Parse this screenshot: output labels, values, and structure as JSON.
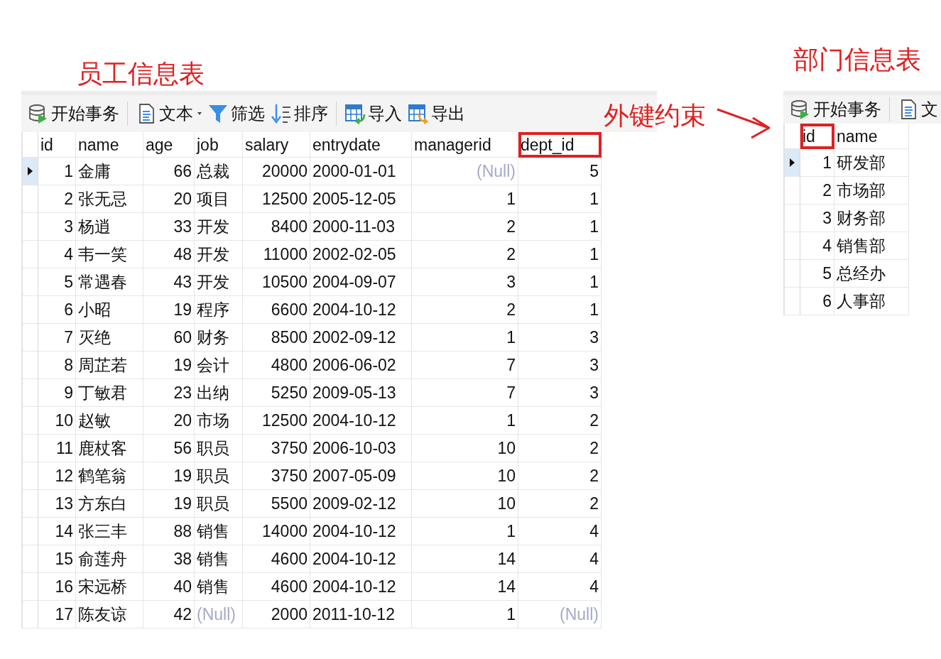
{
  "annotations": {
    "employee_title": "员工信息表",
    "department_title": "部门信息表",
    "foreign_key_label": "外键约束"
  },
  "employee_panel": {
    "toolbar": [
      [
        {
          "kind": "transaction",
          "label": "开始事务"
        }
      ],
      [
        {
          "kind": "text",
          "label": "文本",
          "dropdown": true
        },
        {
          "kind": "filter",
          "label": "筛选"
        },
        {
          "kind": "sort",
          "label": "排序"
        }
      ],
      [
        {
          "kind": "import",
          "label": "导入"
        },
        {
          "kind": "export",
          "label": "导出"
        }
      ]
    ],
    "table": {
      "columns": [
        {
          "label": "id",
          "kind": "number",
          "highlighted": false
        },
        {
          "label": "name",
          "kind": "text",
          "highlighted": false
        },
        {
          "label": "age",
          "kind": "number",
          "highlighted": false
        },
        {
          "label": "job",
          "kind": "text",
          "highlighted": false
        },
        {
          "label": "salary",
          "kind": "number",
          "highlighted": false
        },
        {
          "label": "entrydate",
          "kind": "text",
          "highlighted": false
        },
        {
          "label": "managerid",
          "kind": "number",
          "highlighted": false
        },
        {
          "label": "dept_id",
          "kind": "number",
          "highlighted": true
        }
      ],
      "rows": [
        {
          "selected": true,
          "cells": [
            "1",
            "金庸",
            "66",
            "总裁",
            "20000",
            "2000-01-01",
            {
              "kind": "null",
              "text": "(Null)"
            },
            "5"
          ]
        },
        {
          "selected": false,
          "cells": [
            "2",
            "张无忌",
            "20",
            "项目",
            "12500",
            "2005-12-05",
            "1",
            "1"
          ]
        },
        {
          "selected": false,
          "cells": [
            "3",
            "杨逍",
            "33",
            "开发",
            "8400",
            "2000-11-03",
            "2",
            "1"
          ]
        },
        {
          "selected": false,
          "cells": [
            "4",
            "韦一笑",
            "48",
            "开发",
            "11000",
            "2002-02-05",
            "2",
            "1"
          ]
        },
        {
          "selected": false,
          "cells": [
            "5",
            "常遇春",
            "43",
            "开发",
            "10500",
            "2004-09-07",
            "3",
            "1"
          ]
        },
        {
          "selected": false,
          "cells": [
            "6",
            "小昭",
            "19",
            "程序",
            "6600",
            "2004-10-12",
            "2",
            "1"
          ]
        },
        {
          "selected": false,
          "cells": [
            "7",
            "灭绝",
            "60",
            "财务",
            "8500",
            "2002-09-12",
            "1",
            "3"
          ]
        },
        {
          "selected": false,
          "cells": [
            "8",
            "周芷若",
            "19",
            "会计",
            "4800",
            "2006-06-02",
            "7",
            "3"
          ]
        },
        {
          "selected": false,
          "cells": [
            "9",
            "丁敏君",
            "23",
            "出纳",
            "5250",
            "2009-05-13",
            "7",
            "3"
          ]
        },
        {
          "selected": false,
          "cells": [
            "10",
            "赵敏",
            "20",
            "市场",
            "12500",
            "2004-10-12",
            "1",
            "2"
          ]
        },
        {
          "selected": false,
          "cells": [
            "11",
            "鹿杖客",
            "56",
            "职员",
            "3750",
            "2006-10-03",
            "10",
            "2"
          ]
        },
        {
          "selected": false,
          "cells": [
            "12",
            "鹤笔翁",
            "19",
            "职员",
            "3750",
            "2007-05-09",
            "10",
            "2"
          ]
        },
        {
          "selected": false,
          "cells": [
            "13",
            "方东白",
            "19",
            "职员",
            "5500",
            "2009-02-12",
            "10",
            "2"
          ]
        },
        {
          "selected": false,
          "cells": [
            "14",
            "张三丰",
            "88",
            "销售",
            "14000",
            "2004-10-12",
            "1",
            "4"
          ]
        },
        {
          "selected": false,
          "cells": [
            "15",
            "俞莲舟",
            "38",
            "销售",
            "4600",
            "2004-10-12",
            "14",
            "4"
          ]
        },
        {
          "selected": false,
          "cells": [
            "16",
            "宋远桥",
            "40",
            "销售",
            "4600",
            "2004-10-12",
            "14",
            "4"
          ]
        },
        {
          "selected": false,
          "cells": [
            "17",
            "陈友谅",
            "42",
            {
              "kind": "null",
              "text": "(Null)"
            },
            "2000",
            "2011-10-12",
            "1",
            {
              "kind": "null",
              "text": "(Null)"
            }
          ]
        }
      ]
    }
  },
  "department_panel": {
    "toolbar": [
      [
        {
          "kind": "transaction",
          "label": "开始事务"
        }
      ],
      [
        {
          "kind": "text",
          "label": "文",
          "dropdown": false
        }
      ]
    ],
    "table": {
      "columns": [
        {
          "label": "id",
          "kind": "number",
          "highlighted": true
        },
        {
          "label": "name",
          "kind": "text",
          "highlighted": false
        }
      ],
      "rows": [
        {
          "selected": true,
          "cells": [
            "1",
            "研发部"
          ]
        },
        {
          "selected": false,
          "cells": [
            "2",
            "市场部"
          ]
        },
        {
          "selected": false,
          "cells": [
            "3",
            "财务部"
          ]
        },
        {
          "selected": false,
          "cells": [
            "4",
            "销售部"
          ]
        },
        {
          "selected": false,
          "cells": [
            "5",
            "总经办"
          ]
        },
        {
          "selected": false,
          "cells": [
            "6",
            "人事部"
          ]
        }
      ]
    }
  }
}
